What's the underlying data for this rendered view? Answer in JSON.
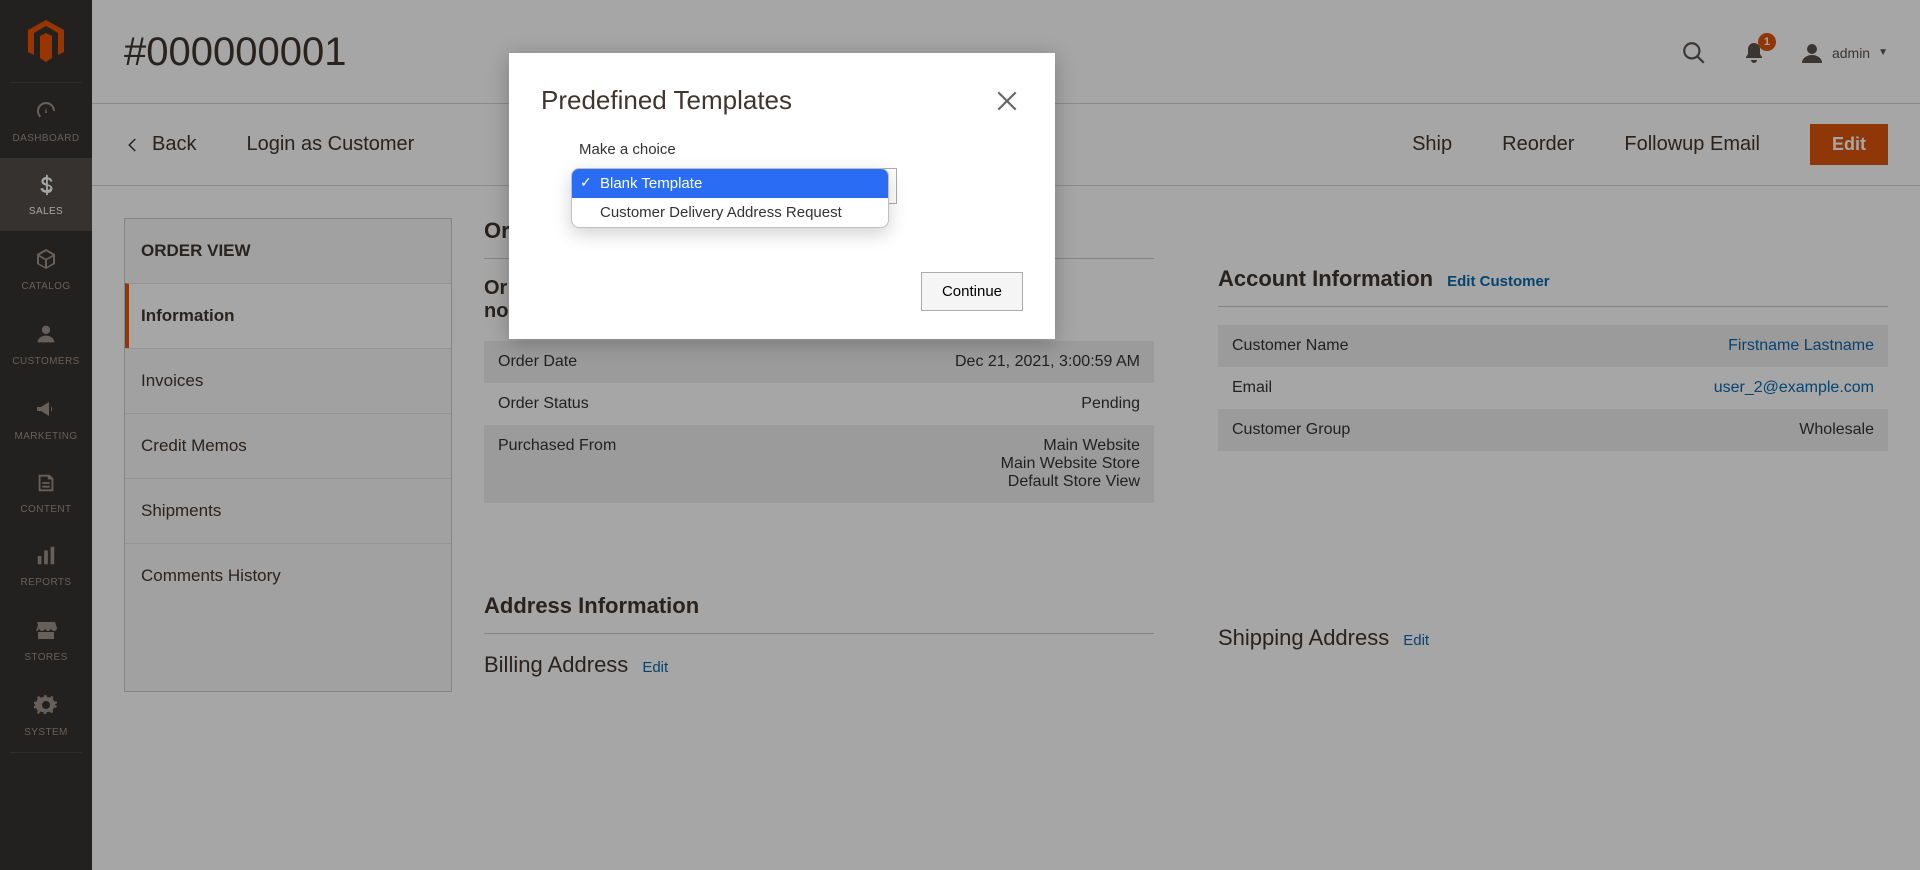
{
  "nav": {
    "items": [
      {
        "icon": "speedometer",
        "label": "DASHBOARD"
      },
      {
        "icon": "dollar",
        "label": "SALES",
        "active": true
      },
      {
        "icon": "cube",
        "label": "CATALOG"
      },
      {
        "icon": "person",
        "label": "CUSTOMERS"
      },
      {
        "icon": "megaphone",
        "label": "MARKETING"
      },
      {
        "icon": "page",
        "label": "CONTENT"
      },
      {
        "icon": "bars",
        "label": "REPORTS"
      },
      {
        "icon": "store",
        "label": "STORES"
      },
      {
        "icon": "gear",
        "label": "SYSTEM"
      }
    ]
  },
  "header": {
    "title": "#000000001",
    "notifications_count": "1",
    "user_label": "admin"
  },
  "toolbar": {
    "back": "Back",
    "login_as_customer": "Login as Customer",
    "ship": "Ship",
    "reorder": "Reorder",
    "followup_email": "Followup Email",
    "edit": "Edit"
  },
  "order_view": {
    "header": "ORDER VIEW",
    "tabs": [
      {
        "label": "Information",
        "active": true
      },
      {
        "label": "Invoices"
      },
      {
        "label": "Credit Memos"
      },
      {
        "label": "Shipments"
      },
      {
        "label": "Comments History"
      }
    ]
  },
  "order_info": {
    "section_title_prefix": "Or",
    "confirm_note_prefix_line1": "Or",
    "confirm_note_prefix_line2": "no",
    "rows": {
      "order_date_label": "Order Date",
      "order_date_value": "Dec 21, 2021, 3:00:59 AM",
      "order_status_label": "Order Status",
      "order_status_value": "Pending",
      "purchased_from_label": "Purchased From",
      "purchased_from_value_line1": "Main Website",
      "purchased_from_value_line2": "Main Website Store",
      "purchased_from_value_line3": "Default Store View"
    }
  },
  "account_info": {
    "section_title": "Account Information",
    "edit_link": "Edit Customer",
    "rows": {
      "customer_name_label": "Customer Name",
      "customer_name_value": "Firstname Lastname",
      "email_label": "Email",
      "email_value": "user_2@example.com",
      "group_label": "Customer Group",
      "group_value": "Wholesale"
    }
  },
  "address_info": {
    "section_title": "Address Information",
    "billing_label": "Billing Address",
    "billing_edit": "Edit",
    "shipping_label": "Shipping Address",
    "shipping_edit": "Edit"
  },
  "modal": {
    "title": "Predefined Templates",
    "label": "Make a choice",
    "options": [
      {
        "label": "Blank Template",
        "selected": true
      },
      {
        "label": "Customer Delivery Address Request"
      }
    ],
    "continue": "Continue"
  },
  "colors": {
    "accent": "#eb5202",
    "link": "#006bb4",
    "nav_bg": "#373330"
  }
}
